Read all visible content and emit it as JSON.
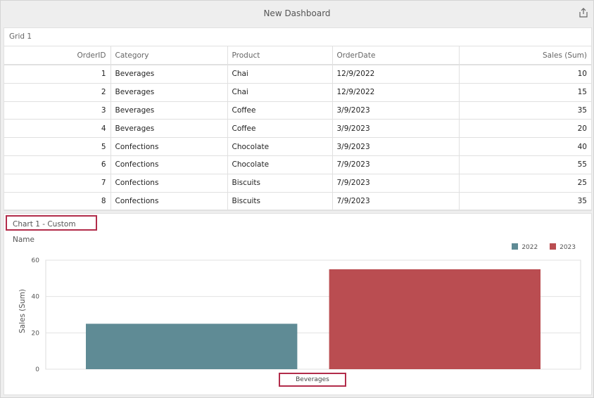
{
  "dashboard": {
    "title": "New Dashboard",
    "export_icon": "export-icon"
  },
  "grid": {
    "caption": "Grid 1",
    "columns": [
      "OrderID",
      "Category",
      "Product",
      "OrderDate",
      "Sales (Sum)"
    ],
    "rows": [
      [
        "1",
        "Beverages",
        "Chai",
        "12/9/2022",
        "10"
      ],
      [
        "2",
        "Beverages",
        "Chai",
        "12/9/2022",
        "15"
      ],
      [
        "3",
        "Beverages",
        "Coffee",
        "3/9/2023",
        "35"
      ],
      [
        "4",
        "Beverages",
        "Coffee",
        "3/9/2023",
        "20"
      ],
      [
        "5",
        "Confections",
        "Chocolate",
        "3/9/2023",
        "40"
      ],
      [
        "6",
        "Confections",
        "Chocolate",
        "7/9/2023",
        "55"
      ],
      [
        "7",
        "Confections",
        "Biscuits",
        "7/9/2023",
        "25"
      ],
      [
        "8",
        "Confections",
        "Biscuits",
        "7/9/2023",
        "35"
      ]
    ]
  },
  "chart": {
    "caption": "Chart 1 - Custom Name"
  },
  "chart_data": {
    "type": "bar",
    "categories": [
      "Beverages"
    ],
    "series": [
      {
        "name": "2022",
        "values": [
          25
        ],
        "color": "#5f8b95"
      },
      {
        "name": "2023",
        "values": [
          55
        ],
        "color": "#ba4d51"
      }
    ],
    "ylabel": "Sales (Sum)",
    "ylim": [
      0,
      60
    ],
    "yticks": [
      "0",
      "20",
      "40",
      "60"
    ],
    "legend_position": "top-right",
    "grid": true
  }
}
